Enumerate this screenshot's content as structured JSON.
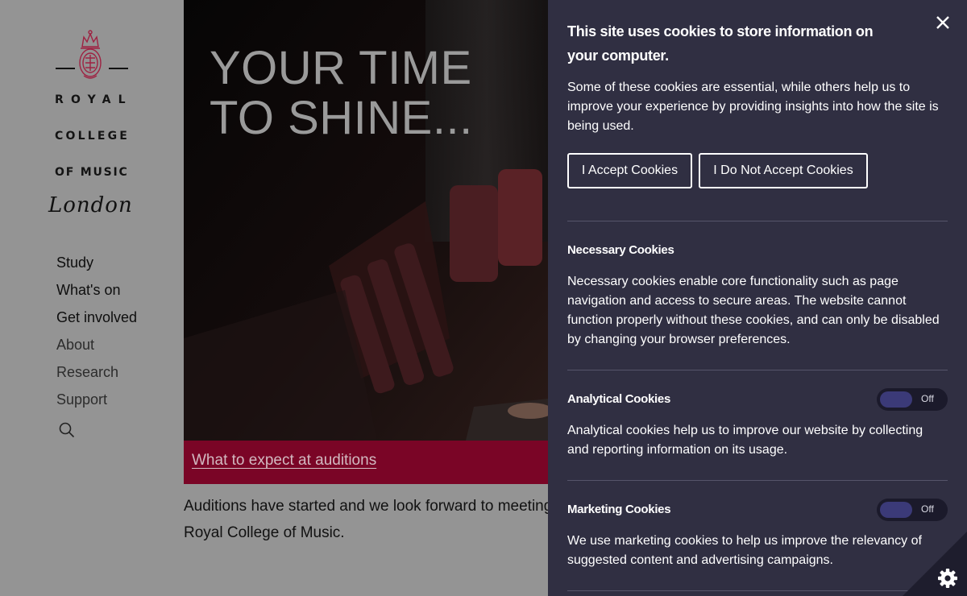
{
  "logo": {
    "word_1": "ROYAL",
    "word_2": "COLLEGE",
    "word_3": "OF MUSIC",
    "word_4": "London",
    "crest_icon": "royal-crest-icon",
    "accent_color": "#9e2242"
  },
  "nav": {
    "items": [
      {
        "label": "Study"
      },
      {
        "label": "What's on"
      },
      {
        "label": "Get involved"
      },
      {
        "label": "About"
      },
      {
        "label": "Research"
      },
      {
        "label": "Support"
      }
    ],
    "search_icon": "search-icon"
  },
  "hero": {
    "title_line1": "YOUR TIME",
    "title_line2": "TO SHINE...",
    "caption_link": "What to expect at auditions",
    "caption_bg": "#7a0526"
  },
  "intro": {
    "text": "Auditions have started and we look forward to meeting you at the Royal College of Music."
  },
  "cookie_panel": {
    "title": "This site uses cookies to store information on your computer.",
    "intro": "Some of these cookies are essential, while others help us to improve your experience by providing insights into how the site is being used.",
    "accept_label": "I Accept Cookies",
    "decline_label": "I Do Not Accept Cookies",
    "close_icon": "close-icon",
    "bg_color": "#302f42",
    "sections": [
      {
        "title": "Necessary Cookies",
        "text": "Necessary cookies enable core functionality such as page navigation and access to secure areas. The website cannot function properly without these cookies, and can only be disabled by changing your browser preferences."
      },
      {
        "title": "Analytical Cookies",
        "toggle_label": "Off",
        "text": "Analytical cookies help us to improve our website by collecting and reporting information on its usage."
      },
      {
        "title": "Marketing Cookies",
        "toggle_label": "Off",
        "text": "We use marketing cookies to help us improve the relevancy of suggested content and advertising campaigns."
      }
    ],
    "settings_icon": "gear-icon"
  }
}
